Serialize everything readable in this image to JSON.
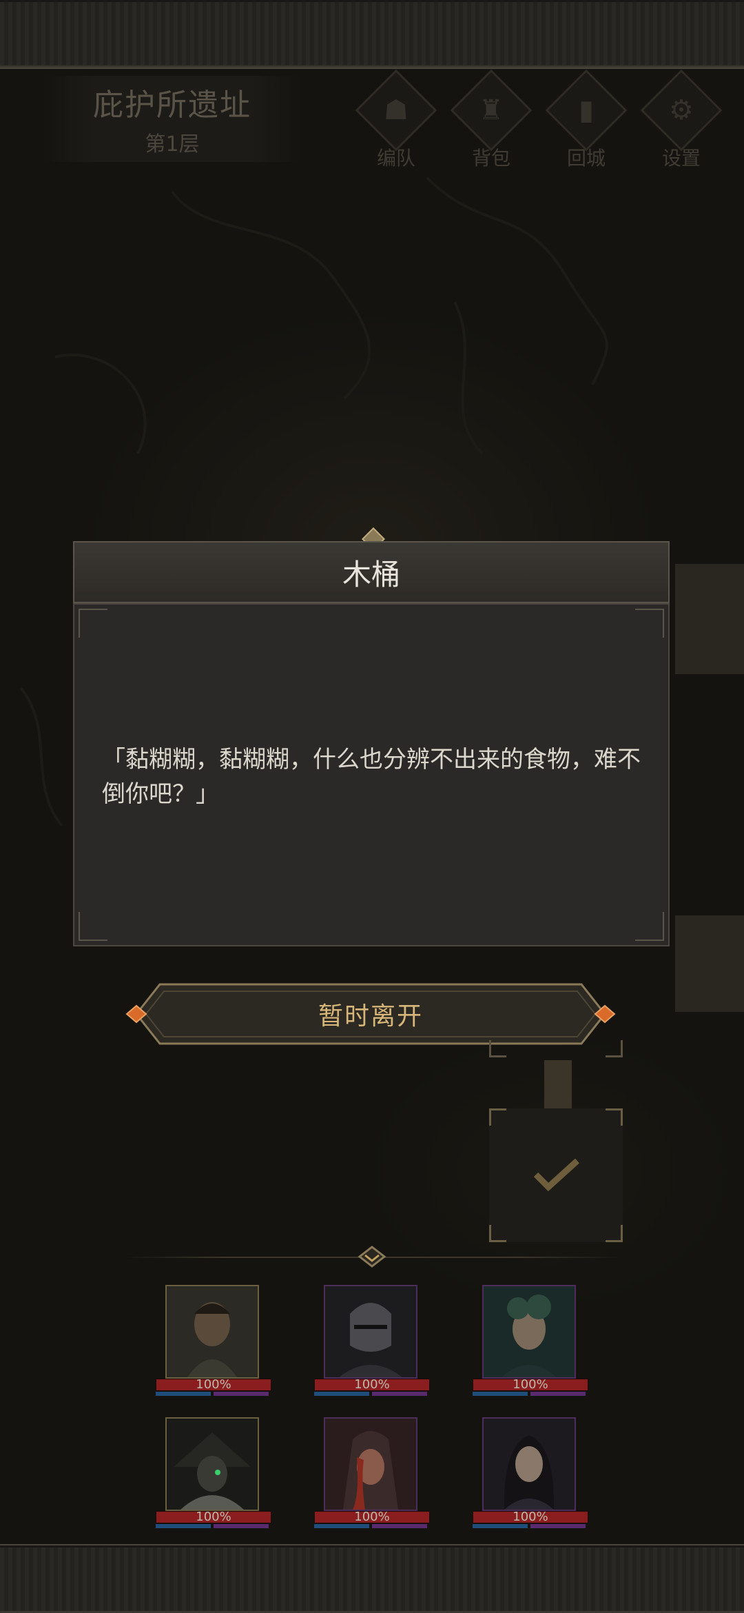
{
  "location": {
    "name": "庇护所遗址",
    "floor": "第1层"
  },
  "top_buttons": [
    {
      "label": "编队",
      "icon": "horned-helmet-icon"
    },
    {
      "label": "背包",
      "icon": "bag-icon"
    },
    {
      "label": "回城",
      "icon": "door-icon"
    },
    {
      "label": "设置",
      "icon": "gear-icon"
    }
  ],
  "dialog": {
    "title": "木桶",
    "text": "「黏糊糊，黏糊糊，什么也分辨不出来的食物，难不倒你吧？」"
  },
  "leave_button": {
    "label": "暂时离开"
  },
  "party": [
    {
      "hp": "100%",
      "hp_fraction": 1.0,
      "icon": "bearded-warrior-portrait"
    },
    {
      "hp": "100%",
      "hp_fraction": 1.0,
      "icon": "armored-knight-portrait"
    },
    {
      "hp": "100%",
      "hp_fraction": 1.0,
      "icon": "curly-hair-youth-portrait"
    },
    {
      "hp": "100%",
      "hp_fraction": 1.0,
      "icon": "hooded-witch-portrait"
    },
    {
      "hp": "100%",
      "hp_fraction": 1.0,
      "icon": "red-hooded-woman-portrait"
    },
    {
      "hp": "100%",
      "hp_fraction": 1.0,
      "icon": "dark-hair-woman-portrait"
    }
  ],
  "colors": {
    "accent_gold": "#d7b679",
    "hp_red": "#8a1e1e",
    "mp_blue": "#1f4e7a",
    "frame": "#2a2825"
  }
}
